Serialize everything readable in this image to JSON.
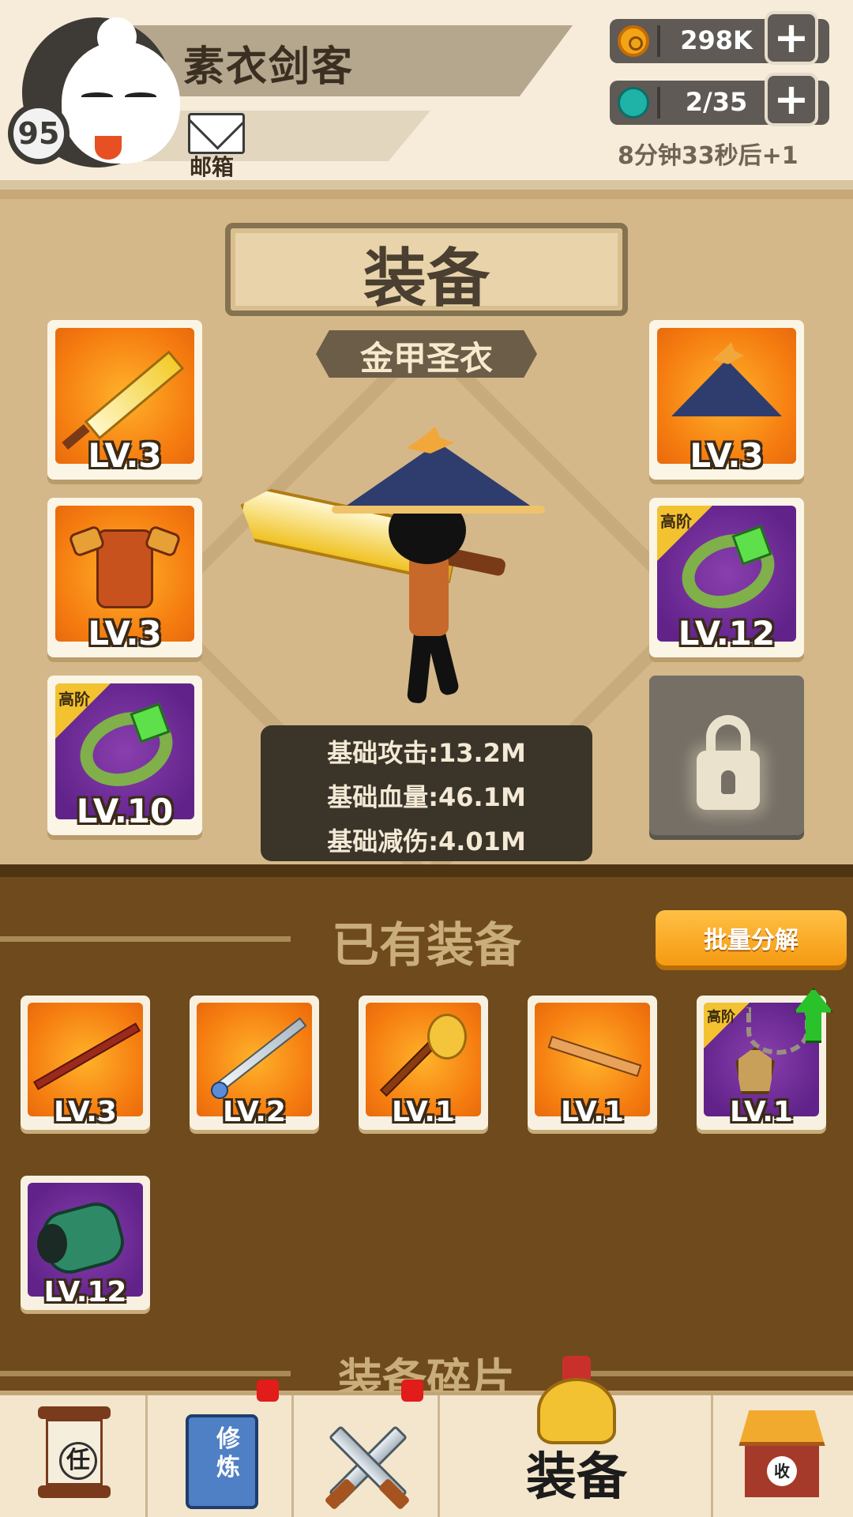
{
  "header": {
    "player_name": "素衣剑客",
    "player_level": "95",
    "mailbox_label": "邮箱",
    "coins": "298K",
    "energy": "2/35",
    "energy_timer": "8分钟33秒后+1",
    "plus_symbol": "+"
  },
  "equipment_panel": {
    "title": "装备",
    "set_name": "金甲圣衣",
    "left_slots": [
      {
        "item": "golden-broadsword",
        "level": "LV.3",
        "rarity": "orange",
        "tier_tag": ""
      },
      {
        "item": "armor-vest",
        "level": "LV.3",
        "rarity": "orange",
        "tier_tag": ""
      },
      {
        "item": "jade-bracelet",
        "level": "LV.10",
        "rarity": "purple",
        "tier_tag": "高阶"
      }
    ],
    "right_slots": [
      {
        "item": "bamboo-hat",
        "level": "LV.3",
        "rarity": "orange",
        "tier_tag": ""
      },
      {
        "item": "jade-bracelet",
        "level": "LV.12",
        "rarity": "purple",
        "tier_tag": "高阶"
      },
      {
        "item": "locked-slot",
        "level": "",
        "rarity": "locked",
        "tier_tag": ""
      }
    ],
    "stats": [
      "基础攻击:13.2M",
      "基础血量:46.1M",
      "基础减伤:4.01M"
    ]
  },
  "owned_section": {
    "title": "已有装备",
    "decompose_button": "批量分解",
    "items": [
      {
        "item": "red-staff",
        "level": "LV.3",
        "rarity": "orange",
        "tier_tag": ""
      },
      {
        "item": "silver-sword",
        "level": "LV.2",
        "rarity": "orange",
        "tier_tag": ""
      },
      {
        "item": "golden-mace",
        "level": "LV.1",
        "rarity": "orange",
        "tier_tag": ""
      },
      {
        "item": "bronze-key-blade",
        "level": "LV.1",
        "rarity": "orange",
        "tier_tag": ""
      },
      {
        "item": "chain-amulet",
        "level": "LV.1",
        "rarity": "purple",
        "tier_tag": "高阶",
        "upgrade_arrow": true
      },
      {
        "item": "jade-gauntlet",
        "level": "LV.12",
        "rarity": "purple",
        "tier_tag": ""
      }
    ],
    "fragments_title": "装备碎片"
  },
  "bottom_nav": {
    "tabs": [
      {
        "icon": "quest-scroll-icon",
        "glyph": "任",
        "label": "",
        "badge": false
      },
      {
        "icon": "cultivation-book-icon",
        "glyph": "修炼",
        "label": "",
        "badge": true
      },
      {
        "icon": "crossed-swords-icon",
        "glyph": "",
        "label": "",
        "badge": true
      },
      {
        "icon": "helmet-icon",
        "glyph": "",
        "label": "装备",
        "badge": false,
        "active": true
      },
      {
        "icon": "shop-icon",
        "glyph": "收",
        "label": "",
        "badge": false
      }
    ]
  },
  "colors": {
    "header_bg": "#f6ecd9",
    "panel_bg": "#d4b889",
    "owned_bg": "#6e4a1d",
    "orange_rarity": "#f57c10",
    "purple_rarity": "#61238a",
    "decompose_button": "#f59a12",
    "upgrade_arrow": "#29c22a",
    "badge_red": "#e21b1b"
  }
}
